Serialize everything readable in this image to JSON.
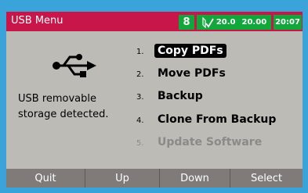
{
  "titlebar": {
    "title": "USB Menu"
  },
  "status": {
    "lock_glyph": "8",
    "temperature": "20.0",
    "voltage": "20.00",
    "time": "20:07"
  },
  "icons": {
    "usb": "usb-icon",
    "probe": "probe-check-icon"
  },
  "message": {
    "line1": "USB removable",
    "line2": "storage detected."
  },
  "menu": {
    "items": [
      {
        "num": "1.",
        "label": "Copy PDFs"
      },
      {
        "num": "2.",
        "label": "Move PDFs"
      },
      {
        "num": "3.",
        "label": "Backup"
      },
      {
        "num": "4.",
        "label": "Clone From Backup"
      },
      {
        "num": "5.",
        "label": "Update Software"
      }
    ],
    "selected": "Copy PDFs",
    "disabled": "Update Software"
  },
  "softkeys": {
    "quit": "Quit",
    "up": "Up",
    "down": "Down",
    "select": "Select"
  },
  "colors": {
    "titlebar": "#c8164a",
    "status": "#12a73b",
    "panel": "#bdbbb5",
    "softkeys": "#807a78",
    "frame": "#3aa4da"
  }
}
